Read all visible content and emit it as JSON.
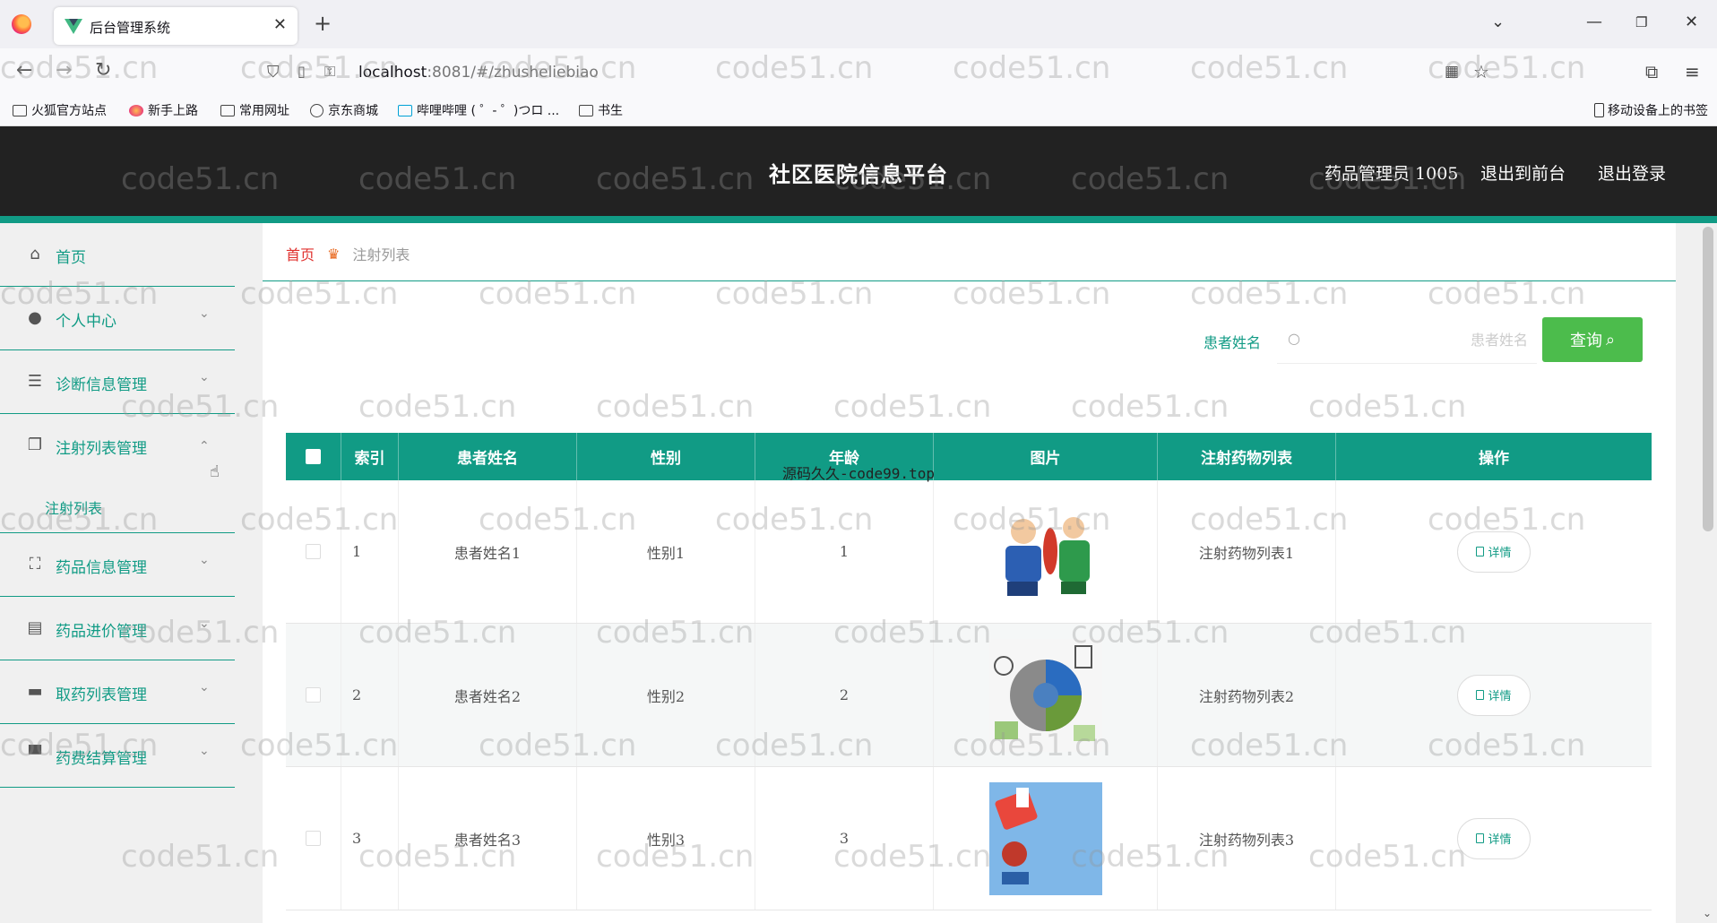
{
  "browser": {
    "tab_title": "后台管理系统",
    "tab_close": "✕",
    "new_tab": "+",
    "url_host": "localhost",
    "url_rest": ":8081/#/zhusheliebiao",
    "bookmarks": [
      {
        "label": "火狐官方站点",
        "icon": "folder"
      },
      {
        "label": "新手上路",
        "icon": "firefox"
      },
      {
        "label": "常用网址",
        "icon": "folder"
      },
      {
        "label": "京东商城",
        "icon": "globe"
      },
      {
        "label": "哔哩哔哩 ( ゜- ゜)つロ ...",
        "icon": "bilibili"
      },
      {
        "label": "书生",
        "icon": "folder"
      }
    ],
    "mobile_bookmarks": "移动设备上的书签"
  },
  "header": {
    "title": "社区医院信息平台",
    "user": "药品管理员 1005",
    "exit_front": "退出到前台",
    "logout": "退出登录"
  },
  "sidebar": {
    "items": [
      {
        "label": "首页",
        "icon": "home-icon"
      },
      {
        "label": "个人中心",
        "icon": "user-icon"
      },
      {
        "label": "诊断信息管理",
        "icon": "sliders-icon"
      },
      {
        "label": "注射列表管理",
        "icon": "copy-icon"
      },
      {
        "label": "药品信息管理",
        "icon": "fullscreen-icon"
      },
      {
        "label": "药品进价管理",
        "icon": "clipboard-icon"
      },
      {
        "label": "取药列表管理",
        "icon": "briefcase-icon"
      },
      {
        "label": "药费结算管理",
        "icon": "monitor-icon"
      }
    ],
    "submenu": {
      "label": "注射列表"
    }
  },
  "breadcrumb": {
    "home": "首页",
    "current": "注射列表"
  },
  "search": {
    "label": "患者姓名",
    "placeholder": "患者姓名",
    "button": "查询"
  },
  "table": {
    "headers": [
      "索引",
      "患者姓名",
      "性别",
      "年龄",
      "图片",
      "注射药物列表",
      "操作"
    ],
    "rows": [
      {
        "index": "1",
        "name": "患者姓名1",
        "gender": "性别1",
        "age": "1",
        "drugs": "注射药物列表1",
        "action": "详情"
      },
      {
        "index": "2",
        "name": "患者姓名2",
        "gender": "性别2",
        "age": "2",
        "drugs": "注射药物列表2",
        "action": "详情"
      },
      {
        "index": "3",
        "name": "患者姓名3",
        "gender": "性别3",
        "age": "3",
        "drugs": "注射药物列表3",
        "action": "详情"
      }
    ]
  },
  "watermark": "code51.cn",
  "overlay_text": "源码久久-code99.top",
  "colors": {
    "accent": "#119b85",
    "header_bg": "#222222",
    "search_btn": "#4cbc4c",
    "breadcrumb_home": "#e0312e"
  }
}
